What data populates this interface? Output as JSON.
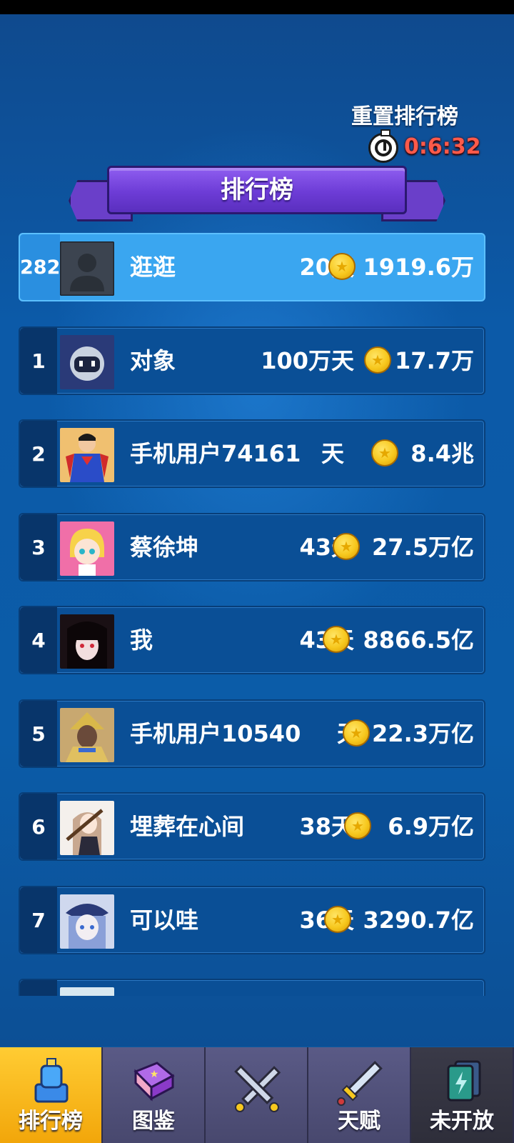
{
  "reset": {
    "label": "重置排行榜",
    "timer": "0:6:32"
  },
  "title": "排行榜",
  "me": {
    "rank": "282",
    "name": "逛逛",
    "days": "20天",
    "score": "1919.6万"
  },
  "rows": [
    {
      "rank": "1",
      "name": "对象",
      "days": "100万天",
      "score": "17.7万"
    },
    {
      "rank": "2",
      "name": "手机用户74161",
      "days": "天",
      "score": "8.4兆"
    },
    {
      "rank": "3",
      "name": "蔡徐坤",
      "days": "43天",
      "score": "27.5万亿"
    },
    {
      "rank": "4",
      "name": "我",
      "days": "43天",
      "score": "8866.5亿"
    },
    {
      "rank": "5",
      "name": "手机用户10540",
      "days": "天",
      "score": "22.3万亿"
    },
    {
      "rank": "6",
      "name": "埋葬在心间",
      "days": "38天",
      "score": "6.9万亿"
    },
    {
      "rank": "7",
      "name": "可以哇",
      "days": "36天",
      "score": "3290.7亿"
    }
  ],
  "tabs": [
    {
      "label": "排行榜",
      "icon": "trophy-icon"
    },
    {
      "label": "图鉴",
      "icon": "book-icon"
    },
    {
      "label": "",
      "icon": "crossed-swords-icon"
    },
    {
      "label": "天赋",
      "icon": "sword-icon"
    },
    {
      "label": "未开放",
      "icon": "cards-icon"
    }
  ],
  "colors": {
    "timer": "#ff5a4a",
    "me_row": "#3aa6f0",
    "active_tab": "#ffcc33"
  }
}
